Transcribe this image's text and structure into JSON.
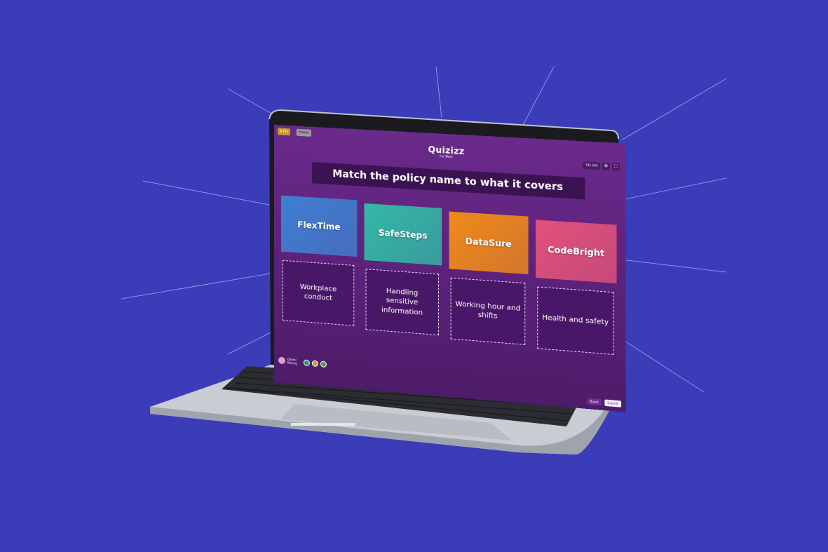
{
  "app": {
    "logo": "Quizizz",
    "logo_sub": "For Work",
    "badge_left": "4 Pts",
    "badge_right": "Power",
    "timer": "792",
    "score": "545"
  },
  "question": {
    "text": "Match the policy name to what it covers"
  },
  "options": [
    {
      "label": "FlexTime",
      "color": "#3f7fd0"
    },
    {
      "label": "SafeSteps",
      "color": "#32b8a6"
    },
    {
      "label": "DataSure",
      "color": "#f08a1a"
    },
    {
      "label": "CodeBright",
      "color": "#e0527a"
    }
  ],
  "targets": [
    {
      "label": "Workplace conduct"
    },
    {
      "label": "Handling sensitive information"
    },
    {
      "label": "Working hour and shifts"
    },
    {
      "label": "Health and safety"
    }
  ],
  "player": {
    "name": "Daniel Murray"
  },
  "footer": {
    "reset_label": "Reset",
    "submit_label": "Submit"
  }
}
